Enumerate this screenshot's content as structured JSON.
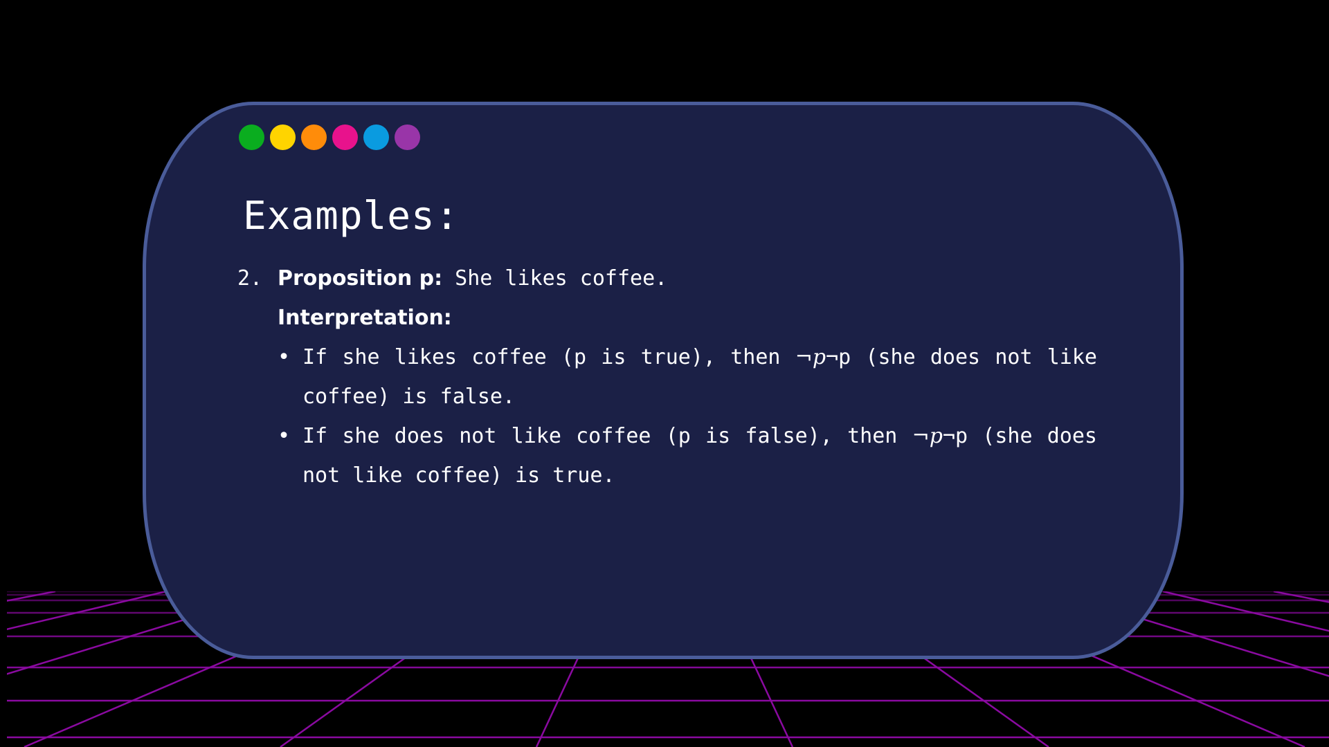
{
  "dots": [
    {
      "name": "green-dot",
      "color": "#0aad1f"
    },
    {
      "name": "yellow-dot",
      "color": "#ffd400"
    },
    {
      "name": "orange-dot",
      "color": "#ff8c0a"
    },
    {
      "name": "pink-dot",
      "color": "#e8128c"
    },
    {
      "name": "blue-dot",
      "color": "#0a9be0"
    },
    {
      "name": "purple-dot",
      "color": "#9935a8"
    }
  ],
  "title": "Examples:",
  "item": {
    "number": "2.",
    "label": "Proposition p:",
    "text": " She likes coffee.",
    "interpretation_label": "Interpretation:",
    "bullets": [
      {
        "marker": "•",
        "before": "If she likes coffee (p is true), then ",
        "math": "¬p",
        "after": "¬p (she does not like coffee) is false."
      },
      {
        "marker": "•",
        "before": "If she does not like coffee (p is false), then ",
        "math": "¬p",
        "after": "¬p (she does not like coffee) is true."
      }
    ]
  },
  "colors": {
    "background": "#000000",
    "card": "#1b2046",
    "card_border": "#4a5c9a",
    "grid_line": "#8a0aa0"
  }
}
